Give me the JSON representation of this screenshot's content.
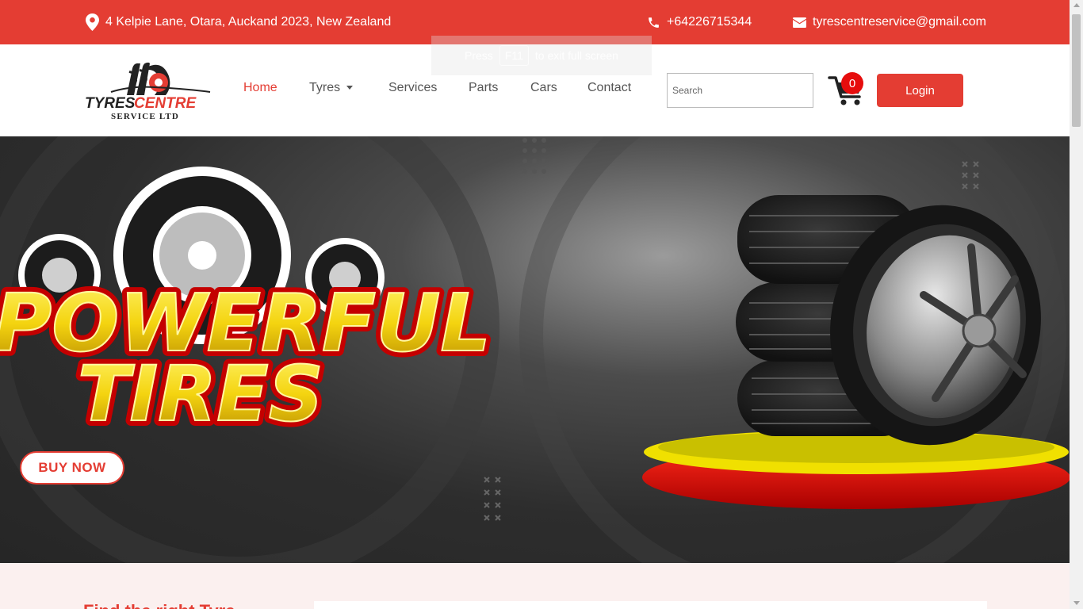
{
  "topbar": {
    "address": "4 Kelpie Lane, Otara, Auckand 2023, New Zealand",
    "phone": "+64226715344",
    "email": "tyrescentreservice@gmail.com",
    "icons": [
      "location-pin-icon",
      "phone-icon",
      "envelope-icon"
    ]
  },
  "logo": {
    "line1": "TYRES CENTRE",
    "line2": "SERVICE LTD"
  },
  "nav": {
    "items": [
      {
        "label": "Home",
        "active": true
      },
      {
        "label": "Tyres",
        "dropdown": true
      },
      {
        "label": "Services"
      },
      {
        "label": "Parts"
      },
      {
        "label": "Cars"
      },
      {
        "label": "Contact"
      }
    ]
  },
  "search": {
    "placeholder": "Search"
  },
  "cart": {
    "count": "0"
  },
  "login": {
    "label": "Login"
  },
  "fullscreen_toast": {
    "before": "Press",
    "key": "F11",
    "after": "to exit full screen"
  },
  "hero": {
    "headline_line1": "POWERFUL",
    "headline_line2": "TIRES",
    "cta": "BUY NOW"
  },
  "section": {
    "title": "Find the right Tyre"
  },
  "colors": {
    "brand": "#e43d33",
    "badge": "#e60d0d",
    "section_bg": "#fbf0ef"
  }
}
